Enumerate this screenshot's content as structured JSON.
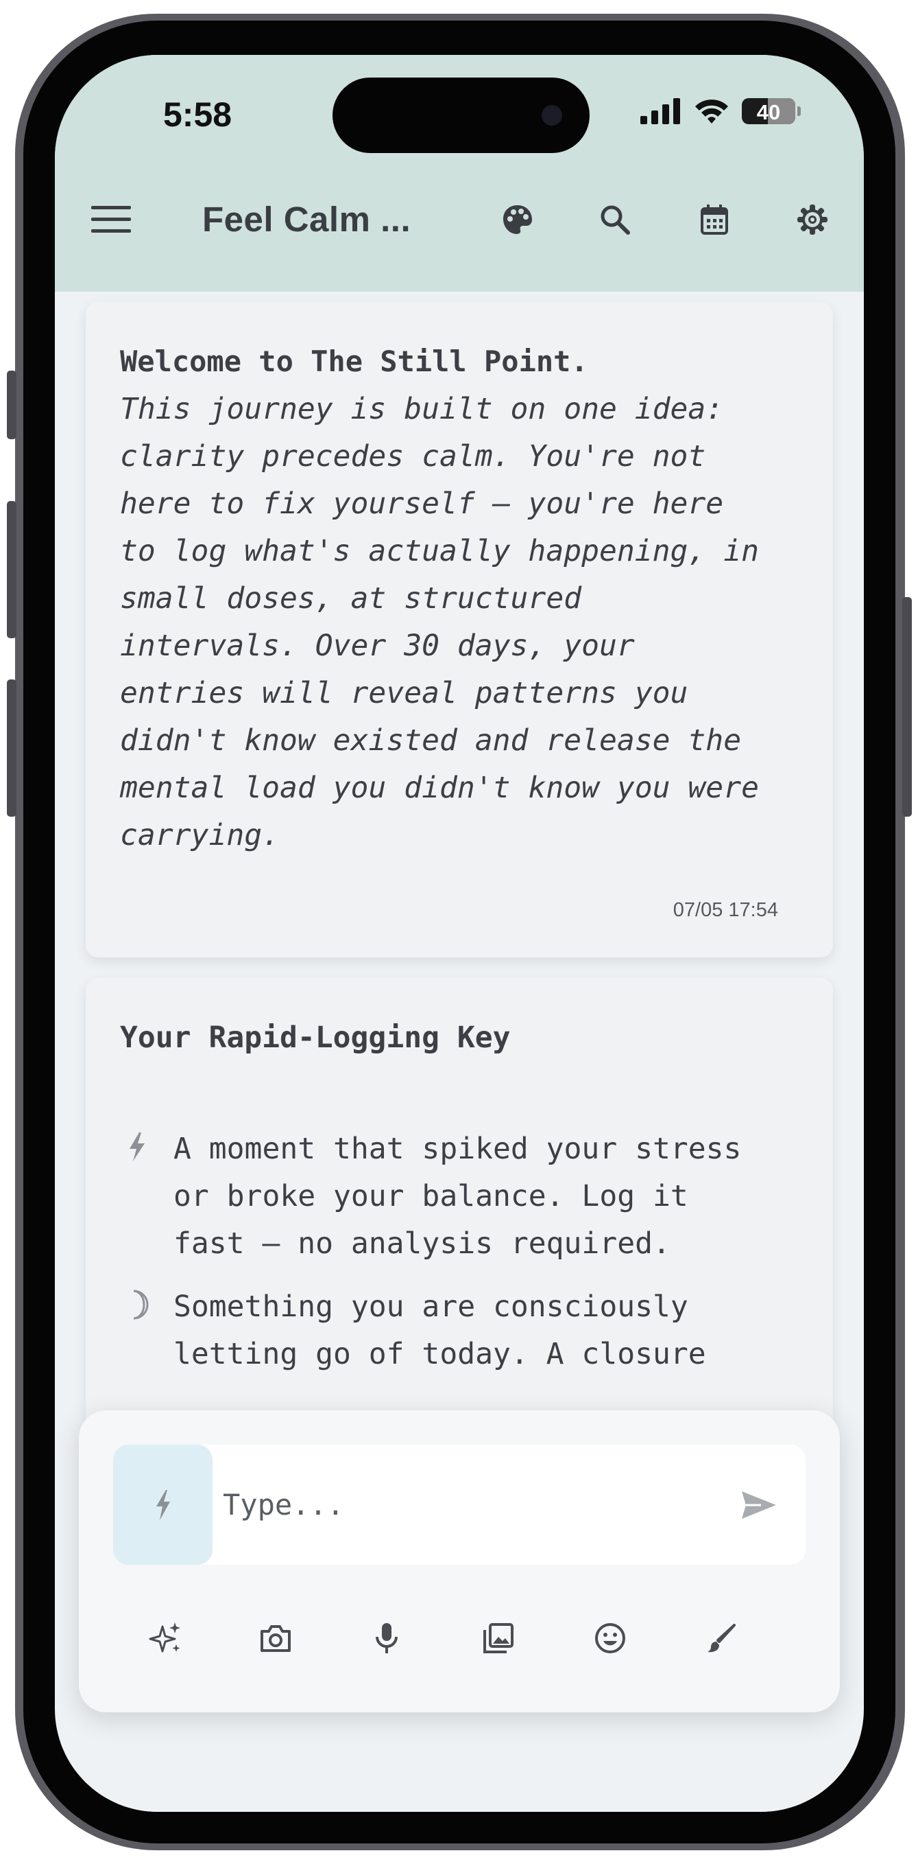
{
  "status_bar": {
    "time": "5:58",
    "battery": "40"
  },
  "app_bar": {
    "title": "Feel Calm ...",
    "icons": [
      "menu-icon",
      "palette-icon",
      "search-icon",
      "calendar-icon",
      "settings-icon"
    ]
  },
  "entries": [
    {
      "title": "Welcome to The Still Point.",
      "body_lines": [
        "This journey is built on one idea:",
        "clarity precedes calm. You're not",
        "here to fix yourself — you're here",
        "to log what's actually happening, in",
        "small doses, at structured",
        "intervals. Over 30 days, your",
        "entries will reveal patterns you",
        "didn't know existed and release the",
        "mental load you didn't know you were",
        "carrying."
      ],
      "timestamp": "07/05 17:54"
    }
  ],
  "key_card": {
    "title": "Your Rapid-Logging Key",
    "items": [
      {
        "icon": "bolt-icon",
        "lines": [
          "A moment that spiked your stress",
          "or broke your balance. Log it",
          "fast — no analysis required."
        ]
      },
      {
        "icon": "moon-icon",
        "lines": [
          "Something you are consciously",
          "letting go of today. A closure"
        ]
      }
    ]
  },
  "composer": {
    "type_icon": "bolt-icon",
    "placeholder": "Type...",
    "send_icon": "send-icon",
    "tools": [
      "sparkle-icon",
      "camera-icon",
      "microphone-icon",
      "gallery-icon",
      "emoji-icon",
      "brush-icon"
    ]
  },
  "colors": {
    "header_bg": "#cfe1dc",
    "screen_bg": "#eef2f4",
    "card_bg": "#f1f2f3",
    "text": "#3c4044",
    "type_button_bg": "#ddeef5"
  }
}
